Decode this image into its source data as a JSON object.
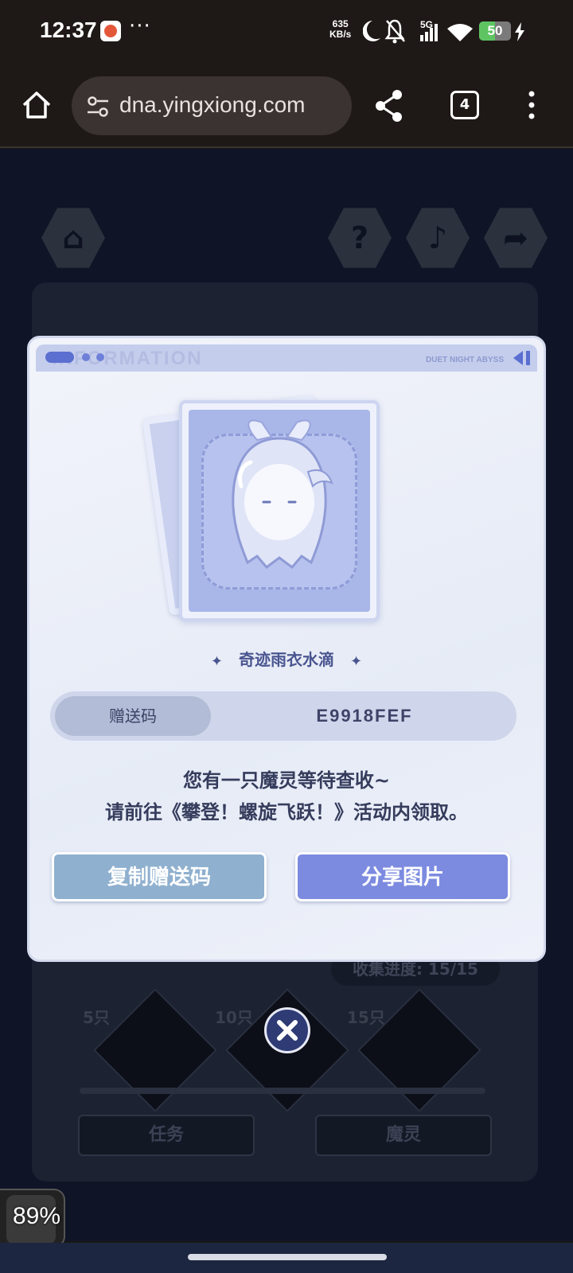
{
  "status_bar": {
    "time": "12:37",
    "more": "···",
    "net_speed_value": "635",
    "net_speed_unit": "KB/s",
    "network": "5G",
    "battery_level": 50,
    "battery_label": "50",
    "icons": [
      "dnd-moon-icon",
      "mute-bell-icon",
      "signal-icon",
      "wifi-icon",
      "charging-icon"
    ]
  },
  "browser": {
    "url": "dna.yingxiong.com",
    "tab_count": "4",
    "icons": [
      "home-icon",
      "site-settings-icon",
      "share-icon",
      "more-vertical-icon"
    ]
  },
  "background_page": {
    "progress_text": "收集进度: 15/15",
    "milestones": [
      "5只",
      "10只",
      "15只"
    ],
    "tabs": [
      "任务",
      "魔灵"
    ]
  },
  "modal": {
    "header_ghost_text": "INFORMATION",
    "header_brand": "DUET NIGHT ABYSS",
    "spirit_name": "奇迹雨衣水滴",
    "code_label": "赠送码",
    "code_value": "E9918FEF",
    "message_line1": "您有一只魔灵等待查收~",
    "message_line2": "请前往《攀登！螺旋飞跃！》活动内领取。",
    "copy_button": "复制赠送码",
    "share_button": "分享图片"
  },
  "overlay": {
    "percent": "89%"
  },
  "colors": {
    "modal_bg": "#eef1fa",
    "accent_blue": "#7c8be0",
    "copy_button": "#8fb0cf",
    "close_button": "#2f3b74"
  }
}
